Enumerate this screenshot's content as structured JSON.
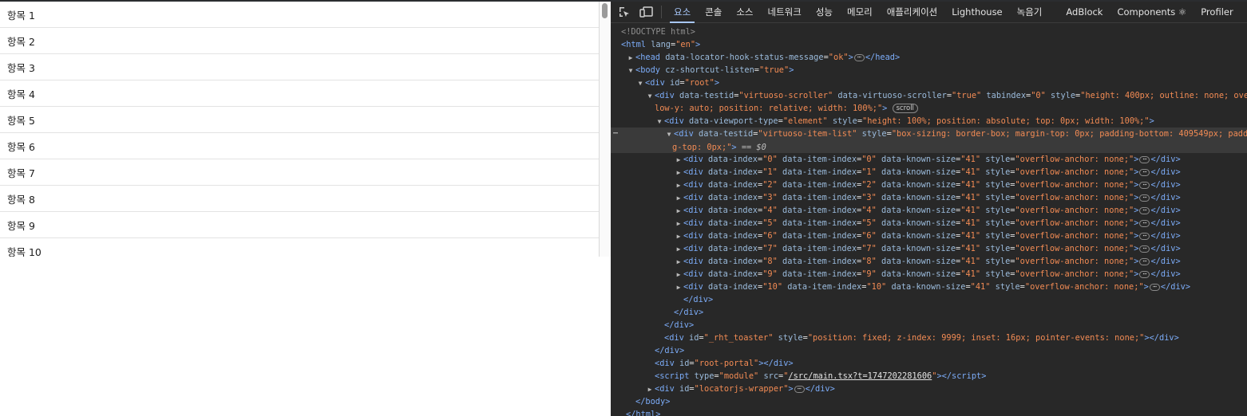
{
  "page": {
    "items": [
      "항목 1",
      "항목 2",
      "항목 3",
      "항목 4",
      "항목 5",
      "항목 6",
      "항목 7",
      "항목 8",
      "항목 9",
      "항목 10"
    ]
  },
  "devtools": {
    "tabs": [
      "요소",
      "콘솔",
      "소스",
      "네트워크",
      "성능",
      "메모리",
      "애플리케이션",
      "Lighthouse",
      "녹음기",
      "AdBlock",
      "Components ⚛",
      "Profiler"
    ],
    "active_tab": "요소",
    "selected_suffix": "== $0",
    "scroll_badge": "scroll",
    "script_src": "/src/main.tsx?t=1747202281606",
    "item_known_size": "41"
  },
  "colors": {
    "devtools_bg": "#282828",
    "tag": "#7cacf8",
    "attr_name": "#9bbbdc",
    "attr_value": "#f28b54",
    "active_tab": "#a8c7fa"
  }
}
